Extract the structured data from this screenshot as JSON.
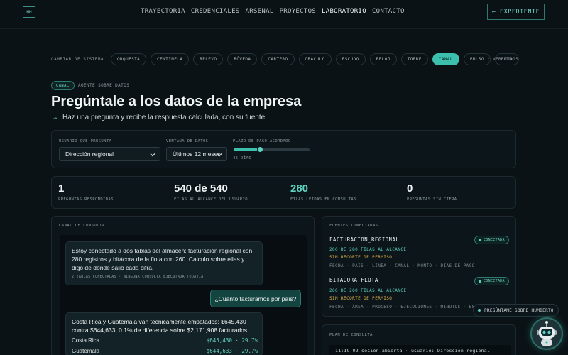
{
  "nav": {
    "logo": "HH",
    "links": [
      "TRAYECTORIA",
      "CREDENCIALES",
      "ARSENAL",
      "PROYECTOS",
      "LABORATORIO",
      "CONTACTO"
    ],
    "active_link": "LABORATORIO",
    "cta": "← EXPEDIENTE"
  },
  "systems": {
    "label": "CAMBIAR DE SISTEMA",
    "items": [
      "ORQUESTA",
      "CENTINELA",
      "RELEVO",
      "BÓVEDA",
      "CARTERO",
      "ORÁCULO",
      "ESCUDO",
      "RELOJ",
      "TORRE",
      "CANAL",
      "PULSO",
      "RUTA"
    ],
    "active": "CANAL",
    "view_all": "↑ VER TODOS"
  },
  "hero": {
    "tag": "CANAL",
    "tag_desc": "AGENTE SOBRE DATOS",
    "title": "Pregúntale a los datos de la empresa",
    "subtitle": "Haz una pregunta y recibe la respuesta calculada, con su fuente."
  },
  "controls": {
    "user_label": "USUARIO QUE PREGUNTA",
    "user_value": "Dirección regional",
    "window_label": "VENTANA DE DATOS",
    "window_value": "Últimos 12 meses",
    "term_label": "PLAZO DE PAGO ACORDADO",
    "term_value": "45 DÍAS",
    "term_fraction": 0.35
  },
  "stats": [
    {
      "value": "1",
      "label": "PREGUNTAS RESPONDIDAS",
      "accent": false
    },
    {
      "value": "540 de 540",
      "label": "FILAS AL ALCANCE DEL USUARIO",
      "accent": false
    },
    {
      "value": "280",
      "label": "FILAS LEÍDAS EN CONSULTAS",
      "accent": true
    },
    {
      "value": "0",
      "label": "PREGUNTAS SIN CIFRA",
      "accent": false
    }
  ],
  "chat": {
    "label": "CANAL DE CONSULTA",
    "bot_intro": "Estoy conectado a dos tablas del almacén: facturación regional con 280 registros y bitácora de la flota con 260. Calculo sobre ellas y digo de dónde salió cada cifra.",
    "bot_meta": "2 TABLAS CONECTADAS · NINGUNA CONSULTA EJECUTADA TODAVÍA",
    "user_question": "¿Cuánto facturamos por país?",
    "answer_text": "Costa Rica y Guatemala van técnicamente empatados: $645,430 contra $644,633, 0.1% de diferencia sobre $2,171,908 facturados.",
    "answer_rows": [
      {
        "country": "Costa Rica",
        "value": "$645,430 · 29.7%"
      },
      {
        "country": "Guatemala",
        "value": "$644,633 · 29.7%"
      }
    ]
  },
  "sources": {
    "label": "FUENTES CONECTADAS",
    "items": [
      {
        "name": "FACTURACION_REGIONAL",
        "status": "CONECTADA",
        "rows": "280 DE 280 FILAS AL ALCANCE",
        "permission": "SIN RECORTE DE PERMISO",
        "fields": "FECHA · PAÍS · LÍNEA · CANAL · MONTO · DÍAS DE PAGO"
      },
      {
        "name": "BITACORA_FLOTA",
        "status": "CONECTADA",
        "rows": "260 DE 260 FILAS AL ALCANCE",
        "permission": "SIN RECORTE DE PERMISO",
        "fields": "FECHA · ÁREA · PROCESO · EJECUCIONES · MINUTOS · ES"
      }
    ]
  },
  "plan": {
    "label": "PLAN DE CONSULTA",
    "log_line": "11:19:02  sesión abierta · usuario: Dirección regional"
  },
  "assistant": {
    "label": "PREGÚNTAME SOBRE HUMBERTO"
  },
  "colors": {
    "accent": "#3dbfae",
    "warning": "#e0b34a",
    "background": "#0a1216"
  }
}
